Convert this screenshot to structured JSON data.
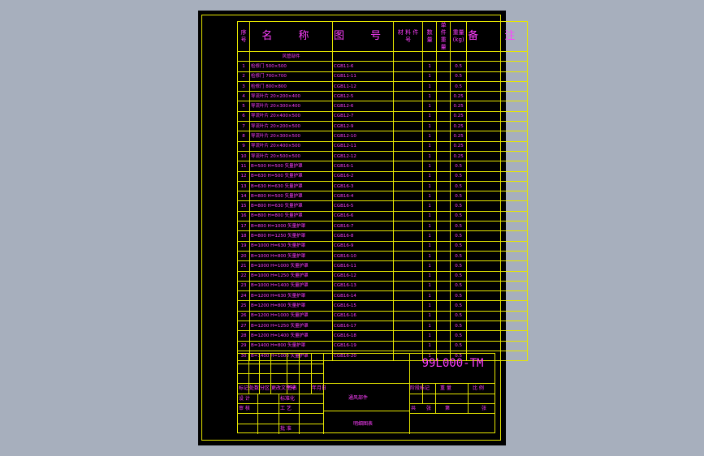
{
  "header": {
    "seq": "序\n号",
    "name": "名 称",
    "drawing_no": "图 号",
    "material": "材 料\n件 号",
    "qty": "数 量",
    "unit_weight": "单 件\n重 量",
    "weight": "重量\n(kg)",
    "remark": "备 注"
  },
  "section_title": "风管部件",
  "rows": [
    {
      "no": "1",
      "name": "检修门  500×500",
      "dwg": "CGB11-6",
      "qty": "1",
      "w": "0.5"
    },
    {
      "no": "2",
      "name": "检修门  700×700",
      "dwg": "CGB11-11",
      "qty": "1",
      "w": "0.5"
    },
    {
      "no": "3",
      "name": "检修门  800×800",
      "dwg": "CGB11-12",
      "qty": "1",
      "w": "0.5"
    },
    {
      "no": "4",
      "name": "导流叶片 20×200×400",
      "dwg": "CGB12-5",
      "qty": "1",
      "w": "0.25"
    },
    {
      "no": "5",
      "name": "导流叶片 20×300×400",
      "dwg": "CGB12-6",
      "qty": "1",
      "w": "0.25"
    },
    {
      "no": "6",
      "name": "导流叶片 20×400×500",
      "dwg": "CGB12-7",
      "qty": "1",
      "w": "0.25"
    },
    {
      "no": "7",
      "name": "导流叶片 20×200×500",
      "dwg": "CGB12-9",
      "qty": "1",
      "w": "0.25"
    },
    {
      "no": "8",
      "name": "导流叶片 20×300×500",
      "dwg": "CGB12-10",
      "qty": "1",
      "w": "0.25"
    },
    {
      "no": "9",
      "name": "导流叶片 20×400×500",
      "dwg": "CGB12-11",
      "qty": "1",
      "w": "0.25"
    },
    {
      "no": "10",
      "name": "导流叶片 20×500×500",
      "dwg": "CGB12-12",
      "qty": "1",
      "w": "0.25"
    },
    {
      "no": "11",
      "name": "B=500 H=500 矢量护罩",
      "dwg": "CGB16-1",
      "qty": "1",
      "w": "0.5"
    },
    {
      "no": "12",
      "name": "B=630 H=500 矢量护罩",
      "dwg": "CGB16-2",
      "qty": "1",
      "w": "0.5"
    },
    {
      "no": "13",
      "name": "B=630 H=630 矢量护罩",
      "dwg": "CGB16-3",
      "qty": "1",
      "w": "0.5"
    },
    {
      "no": "14",
      "name": "B=800 H=500 矢量护罩",
      "dwg": "CGB16-4",
      "qty": "1",
      "w": "0.5"
    },
    {
      "no": "15",
      "name": "B=800 H=630 矢量护罩",
      "dwg": "CGB16-5",
      "qty": "1",
      "w": "0.5"
    },
    {
      "no": "16",
      "name": "B=800 H=800 矢量护罩",
      "dwg": "CGB16-6",
      "qty": "1",
      "w": "0.5"
    },
    {
      "no": "17",
      "name": "B=800 H=1000 矢量护罩",
      "dwg": "CGB16-7",
      "qty": "1",
      "w": "0.5"
    },
    {
      "no": "18",
      "name": "B=800 H=1250 矢量护罩",
      "dwg": "CGB16-8",
      "qty": "1",
      "w": "0.5"
    },
    {
      "no": "19",
      "name": "B=1000 H=630 矢量护罩",
      "dwg": "CGB16-9",
      "qty": "1",
      "w": "0.5"
    },
    {
      "no": "20",
      "name": "B=1000 H=800 矢量护罩",
      "dwg": "CGB16-10",
      "qty": "1",
      "w": "0.5"
    },
    {
      "no": "21",
      "name": "B=1000 H=1000 矢量护罩",
      "dwg": "CGB16-11",
      "qty": "1",
      "w": "0.5"
    },
    {
      "no": "22",
      "name": "B=1000 H=1250 矢量护罩",
      "dwg": "CGB16-12",
      "qty": "1",
      "w": "0.5"
    },
    {
      "no": "23",
      "name": "B=1000 H=1400 矢量护罩",
      "dwg": "CGB16-13",
      "qty": "1",
      "w": "0.5"
    },
    {
      "no": "24",
      "name": "B=1200 H=630 矢量护罩",
      "dwg": "CGB16-14",
      "qty": "1",
      "w": "0.5"
    },
    {
      "no": "25",
      "name": "B=1200 H=800 矢量护罩",
      "dwg": "CGB16-15",
      "qty": "1",
      "w": "0.5"
    },
    {
      "no": "26",
      "name": "B=1200 H=1000 矢量护罩",
      "dwg": "CGB16-16",
      "qty": "1",
      "w": "0.5"
    },
    {
      "no": "27",
      "name": "B=1200 H=1250 矢量护罩",
      "dwg": "CGB16-17",
      "qty": "1",
      "w": "0.5"
    },
    {
      "no": "28",
      "name": "B=1200 H=1400 矢量护罩",
      "dwg": "CGB16-18",
      "qty": "1",
      "w": "0.5"
    },
    {
      "no": "29",
      "name": "B=1400 H=800 矢量护罩",
      "dwg": "CGB16-19",
      "qty": "1",
      "w": "0.5"
    },
    {
      "no": "30",
      "name": "B=1400 H=1000 矢量护罩",
      "dwg": "CGB16-20",
      "qty": "1",
      "w": "0.5"
    }
  ],
  "title_block": {
    "drawing_number": "99L000-TM",
    "project_name": "通风部件",
    "sheet_title": "明细图表",
    "labels": {
      "mark": "标记",
      "count": "处数",
      "zone": "分区",
      "change_no": "更改文件号",
      "sign": "签名",
      "date": "年月日",
      "design": "设 计",
      "standard": "标准化",
      "check": "审 核",
      "process": "工 艺",
      "approve": "批 准",
      "stage": "阶段标记",
      "weight": "重 量",
      "scale": "比 例",
      "total": "共",
      "sheets": "张",
      "page": "第",
      "sheet": "张"
    }
  },
  "colors": {
    "background": "#a7afbd",
    "sheet": "#000000",
    "line": "#e6e600",
    "text": "#ff3fff"
  }
}
